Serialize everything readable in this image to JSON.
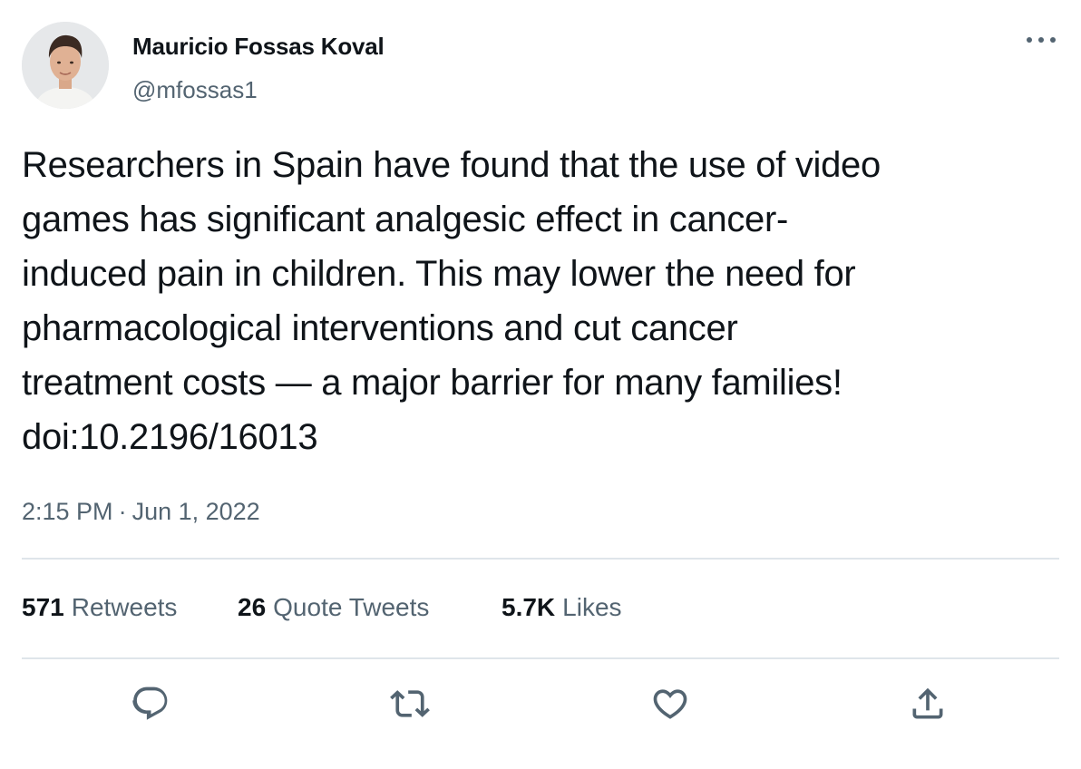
{
  "author": {
    "display_name": "Mauricio Fossas Koval",
    "handle": "@mfossas1"
  },
  "tweet": {
    "text_lines": [
      "Researchers in Spain have found that the use of video",
      "games has significant analgesic effect in cancer-",
      "induced pain in children. This may lower the need for",
      "pharmacological interventions and cut cancer",
      "treatment costs — a major barrier for many families!",
      "doi:10.2196/16013"
    ],
    "time": "2:15 PM",
    "separator": "·",
    "date": "Jun 1, 2022"
  },
  "stats": {
    "retweets": {
      "count": "571",
      "label": "Retweets"
    },
    "quote_tweets": {
      "count": "26",
      "label": "Quote Tweets"
    },
    "likes": {
      "count": "5.7K",
      "label": "Likes"
    }
  },
  "icons": {
    "more": "more-horizontal-icon",
    "reply": "reply-icon",
    "retweet": "retweet-icon",
    "like": "heart-icon",
    "share": "share-icon"
  },
  "colors": {
    "text": "#0f1419",
    "secondary": "#536471",
    "divider": "#dfe5ea"
  }
}
